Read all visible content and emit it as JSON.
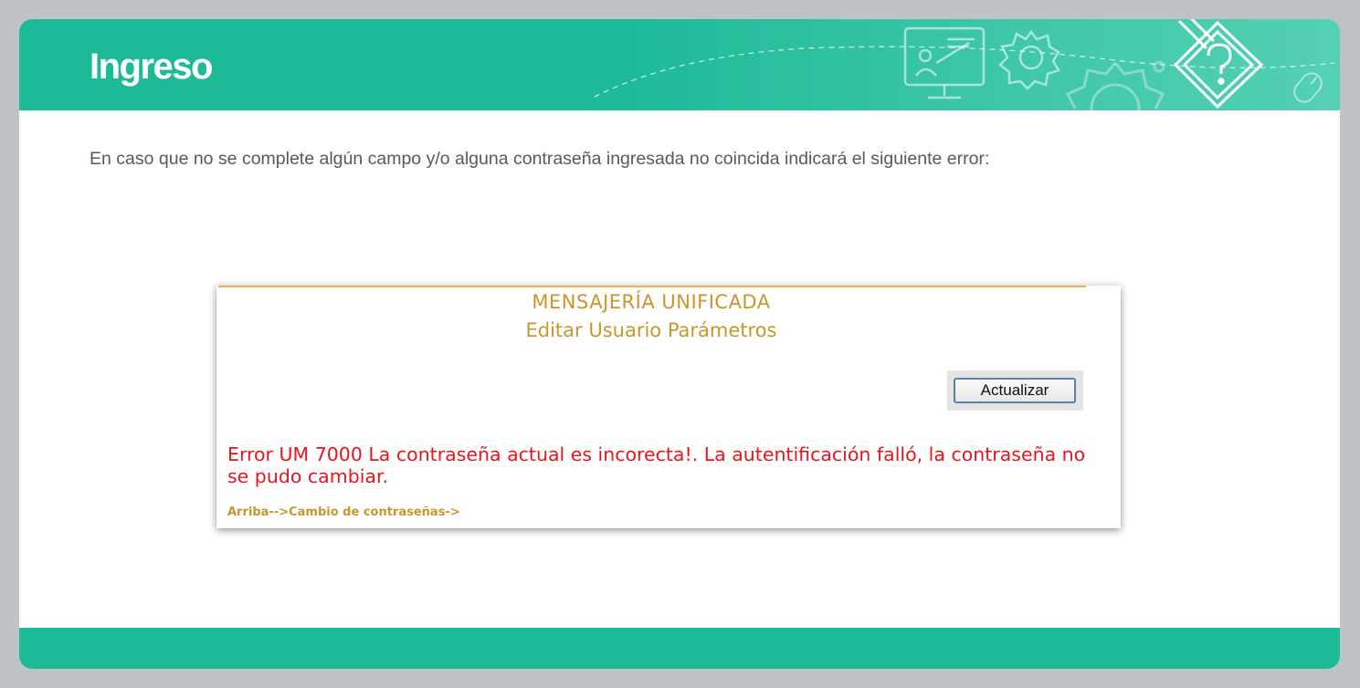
{
  "header": {
    "title": "Ingreso",
    "icons": [
      "monitor-presentation-icon",
      "gear-icon",
      "large-gear-icon",
      "pencil-question-icon",
      "mouse-icon"
    ],
    "color": "#1dba97"
  },
  "intro_text": "En caso que no se complete algún campo y/o alguna contraseña ingresada no coincida indicará el siguiente error:",
  "screenshot": {
    "title": "MENSAJERÍA UNIFICADA",
    "subtitle": "Editar Usuario Parámetros",
    "update_button": "Actualizar",
    "error_message": "Error UM 7000 La contraseña actual es incorecta!. La autentificación falló, la contraseña no se pudo cambiar.",
    "breadcrumb": "Arriba-->Cambio de contraseñas->",
    "colors": {
      "title": "#c9962c",
      "error": "#e8151b"
    }
  },
  "footer": {
    "color": "#1dba97"
  }
}
